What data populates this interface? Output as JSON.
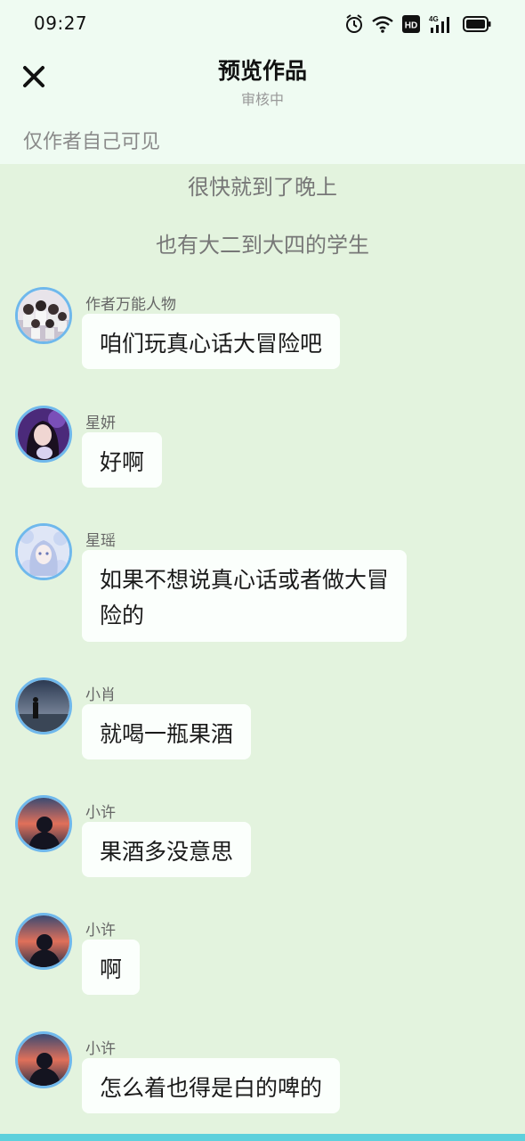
{
  "status_bar": {
    "time": "09:27",
    "icons": [
      "alarm-icon",
      "wifi-icon",
      "hd-icon",
      "signal-4g-icon",
      "battery-icon"
    ],
    "hd_text": "HD",
    "network_text": "4G"
  },
  "header": {
    "close_icon": "close-icon",
    "title": "预览作品",
    "subtitle": "审核中",
    "visibility_note": "仅作者自己可见"
  },
  "narrations": [
    "很快就到了晚上",
    "也有大二到大四的学生"
  ],
  "messages": [
    {
      "sender": "作者万能人物",
      "text": "咱们玩真心话大冒险吧",
      "avatar": "group-photo-avatar"
    },
    {
      "sender": "星妍",
      "text": "好啊",
      "avatar": "girl-portrait-avatar"
    },
    {
      "sender": "星瑶",
      "text_lines": [
        "如果不想说真心话或者做大冒",
        "险的"
      ],
      "avatar": "anime-girl-avatar"
    },
    {
      "sender": "小肖",
      "text": "就喝一瓶果酒",
      "avatar": "silhouette-sea-avatar"
    },
    {
      "sender": "小许",
      "text": "果酒多没意思",
      "avatar": "sunset-silhouette-avatar"
    },
    {
      "sender": "小许",
      "text": "啊",
      "avatar": "sunset-silhouette-avatar"
    },
    {
      "sender": "小许",
      "text": "怎么着也得是白的啤的",
      "avatar": "sunset-silhouette-avatar"
    }
  ],
  "colors": {
    "page_bg": "#e3f3de",
    "header_bg": "#effbf2",
    "bubble_bg": "#fbfffc",
    "avatar_ring": "#6fb8ec",
    "bottom_strip": "#5dd0dc"
  }
}
